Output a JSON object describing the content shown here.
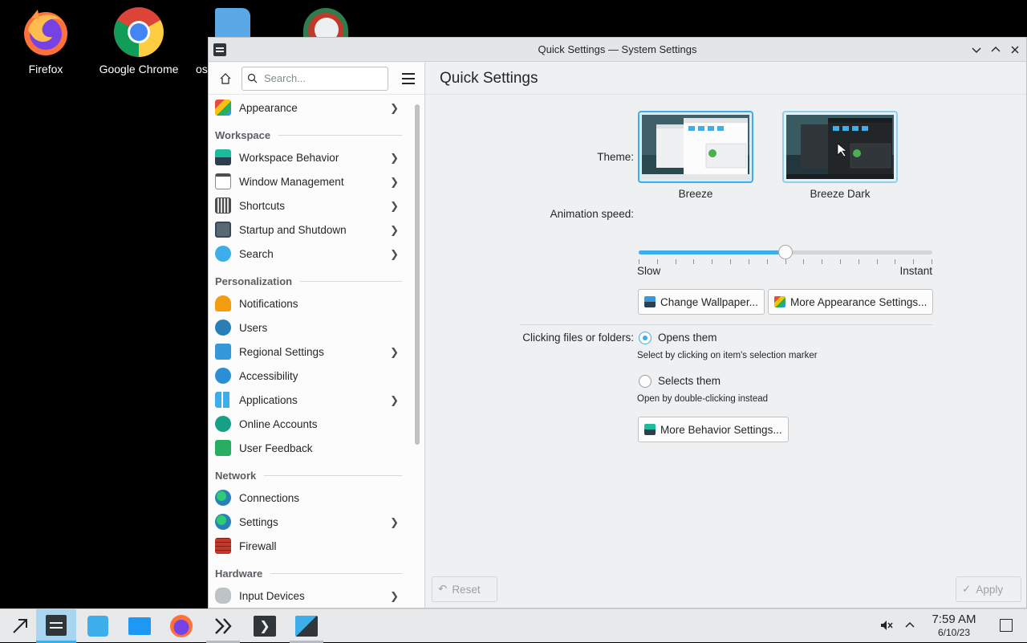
{
  "desktop": {
    "icons": [
      {
        "label": "Firefox",
        "icon": "firefox-icon"
      },
      {
        "label": "Google Chrome",
        "icon": "chrome-icon"
      },
      {
        "label": "os",
        "icon": "file-icon"
      }
    ]
  },
  "window": {
    "title": "Quick Settings — System Settings",
    "controls": [
      "minimize",
      "maximize",
      "close"
    ]
  },
  "sidebar": {
    "search_placeholder": "Search...",
    "top_item": {
      "label": "Appearance",
      "icon": "appearance-icon",
      "has_children": true
    },
    "categories": [
      {
        "name": "Workspace",
        "items": [
          {
            "label": "Workspace Behavior",
            "icon": "workspace-icon",
            "has_children": true
          },
          {
            "label": "Window Management",
            "icon": "window-icon",
            "has_children": true
          },
          {
            "label": "Shortcuts",
            "icon": "keyboard-icon",
            "has_children": true
          },
          {
            "label": "Startup and Shutdown",
            "icon": "startup-icon",
            "has_children": true
          },
          {
            "label": "Search",
            "icon": "search-icon",
            "has_children": true
          }
        ]
      },
      {
        "name": "Personalization",
        "items": [
          {
            "label": "Notifications",
            "icon": "bell-icon",
            "has_children": false
          },
          {
            "label": "Users",
            "icon": "users-icon",
            "has_children": false
          },
          {
            "label": "Regional Settings",
            "icon": "regional-icon",
            "has_children": true
          },
          {
            "label": "Accessibility",
            "icon": "accessibility-icon",
            "has_children": false
          },
          {
            "label": "Applications",
            "icon": "applications-icon",
            "has_children": true
          },
          {
            "label": "Online Accounts",
            "icon": "online-accounts-icon",
            "has_children": false
          },
          {
            "label": "User Feedback",
            "icon": "feedback-icon",
            "has_children": false
          }
        ]
      },
      {
        "name": "Network",
        "items": [
          {
            "label": "Connections",
            "icon": "globe-icon",
            "has_children": false
          },
          {
            "label": "Settings",
            "icon": "globe-icon",
            "has_children": true
          },
          {
            "label": "Firewall",
            "icon": "firewall-icon",
            "has_children": false
          }
        ]
      },
      {
        "name": "Hardware",
        "items": [
          {
            "label": "Input Devices",
            "icon": "mouse-icon",
            "has_children": true
          }
        ]
      }
    ]
  },
  "main": {
    "page_title": "Quick Settings",
    "theme": {
      "label": "Theme:",
      "options": [
        {
          "name": "Breeze",
          "selected": true
        },
        {
          "name": "Breeze Dark",
          "selected": false
        }
      ]
    },
    "animation": {
      "label": "Animation speed:",
      "min_label": "Slow",
      "max_label": "Instant",
      "value_fraction": 0.5
    },
    "buttons": {
      "change_wallpaper": "Change Wallpaper...",
      "more_appearance": "More Appearance Settings...",
      "more_behavior": "More Behavior Settings...",
      "reset": "Reset",
      "apply": "Apply"
    },
    "clicking": {
      "label": "Clicking files or folders:",
      "options": [
        {
          "label": "Opens them",
          "hint": "Select by clicking on item's selection marker",
          "selected": true
        },
        {
          "label": "Selects them",
          "hint": "Open by double-clicking instead",
          "selected": false
        }
      ]
    }
  },
  "taskbar": {
    "clock_time": "7:59 AM",
    "clock_date": "6/10/23",
    "items": [
      "app-launcher",
      "system-settings",
      "discover",
      "dolphin",
      "firefox",
      "kate",
      "konsole",
      "spectacle"
    ]
  },
  "colors": {
    "accent": "#3daee9",
    "window_bg": "#eff0f1",
    "sidebar_bg": "#fcfcfc"
  }
}
